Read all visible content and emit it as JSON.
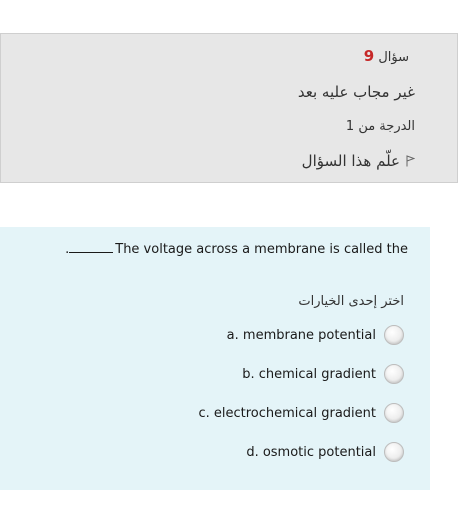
{
  "question_info": {
    "question_label": "سؤال",
    "question_number": "9",
    "state": "غير مجاب عليه بعد",
    "grade": "الدرجة من 1",
    "flag_label": "علّم هذا السؤال",
    "flag_icon": "flag-icon"
  },
  "question": {
    "text": "The voltage across a membrane is called the",
    "blank_suffix": ".",
    "prompt": "اختر إحدى الخيارات",
    "options": [
      {
        "label": "a. membrane potential"
      },
      {
        "label": "b. chemical gradient"
      },
      {
        "label": "c. electrochemical gradient"
      },
      {
        "label": "d. osmotic potential"
      }
    ]
  },
  "colors": {
    "info_bg": "#e7e7e7",
    "content_bg": "#e4f4f8",
    "question_number": "#c62828"
  }
}
